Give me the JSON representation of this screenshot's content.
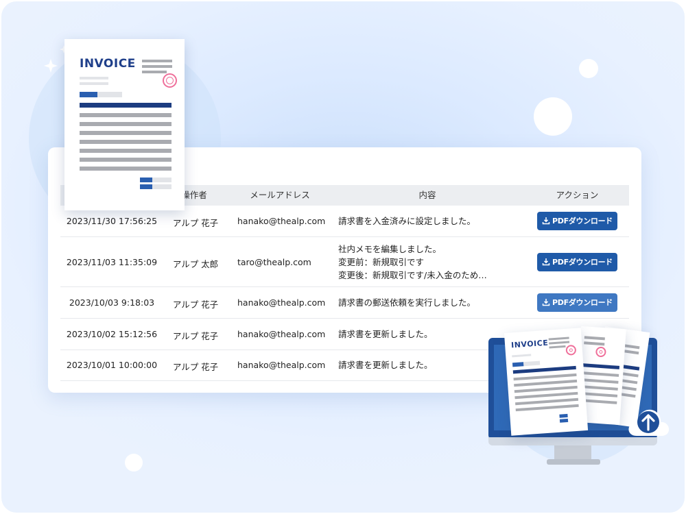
{
  "table": {
    "headers": {
      "user": "操作者",
      "email": "メールアドレス",
      "content": "内容",
      "action": "アクション"
    },
    "download_label": "PDFダウンロード",
    "rows": [
      {
        "date": "2023/11/30 17:56:25",
        "user": "アルプ 花子",
        "email": "hanako@thealp.com",
        "lines": [
          "請求書を入金済みに設定しました。"
        ]
      },
      {
        "date": "2023/11/03 11:35:09",
        "user": "アルプ 太郎",
        "email": "taro@thealp.com",
        "lines": [
          "社内メモを編集しました。",
          "変更前：新規取引です",
          "変更後：新規取引です/未入金のため…"
        ]
      },
      {
        "date": "2023/10/03 9:18:03",
        "user": "アルプ 花子",
        "email": "hanako@thealp.com",
        "lines": [
          "請求書の郵送依頼を実行しました。"
        ]
      },
      {
        "date": "2023/10/02 15:12:56",
        "user": "アルプ 花子",
        "email": "hanako@thealp.com",
        "lines": [
          "請求書を更新しました。"
        ]
      },
      {
        "date": "2023/10/01 10:00:00",
        "user": "アルプ 花子",
        "email": "hanako@thealp.com",
        "lines": [
          "請求書を更新しました。"
        ]
      }
    ]
  },
  "invoice": {
    "title": "INVOICE"
  },
  "monitor_invoice": {
    "title": "INVOICE"
  },
  "icons": {
    "download": "download-icon",
    "upload": "cloud-upload-icon",
    "sparkle": "sparkle-icon"
  },
  "colors": {
    "accent": "#1f5aa8",
    "navy": "#1c3c80",
    "stamp": "#ef6f9a"
  }
}
